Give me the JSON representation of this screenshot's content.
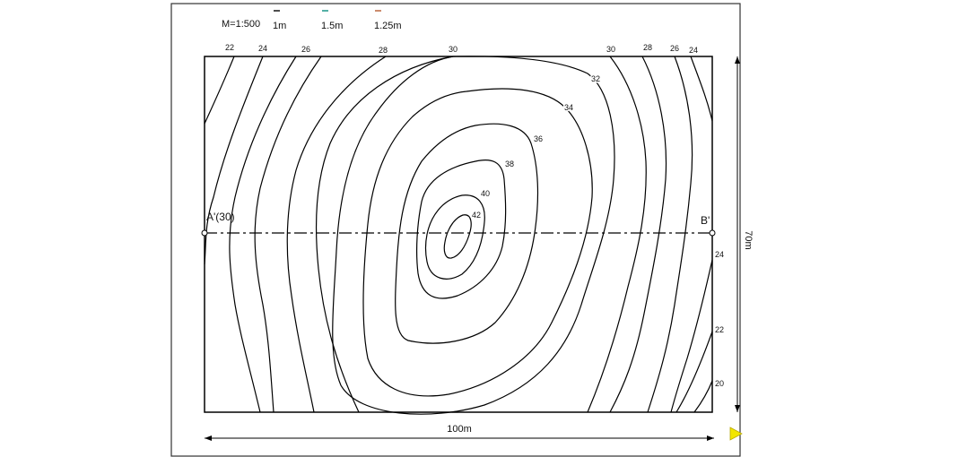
{
  "legend": {
    "scale": "M=1:500",
    "items": [
      {
        "label": "1m",
        "color": "#222222"
      },
      {
        "label": "1.5m",
        "color": "#2a9d8f"
      },
      {
        "label": "1.25m",
        "color": "#c0704a"
      }
    ]
  },
  "contour_labels": {
    "top": [
      "22",
      "24",
      "26",
      "28",
      "30",
      "30",
      "28",
      "26",
      "24"
    ],
    "right": [
      "24",
      "22",
      "20"
    ],
    "inner": [
      "32",
      "34",
      "36",
      "38",
      "40",
      "42"
    ]
  },
  "section": {
    "a_label": "A'(30)",
    "b_label": "B'"
  },
  "dimensions": {
    "width": "100m",
    "height": "70m"
  },
  "colors": {
    "play_marker": "#f2e600"
  }
}
